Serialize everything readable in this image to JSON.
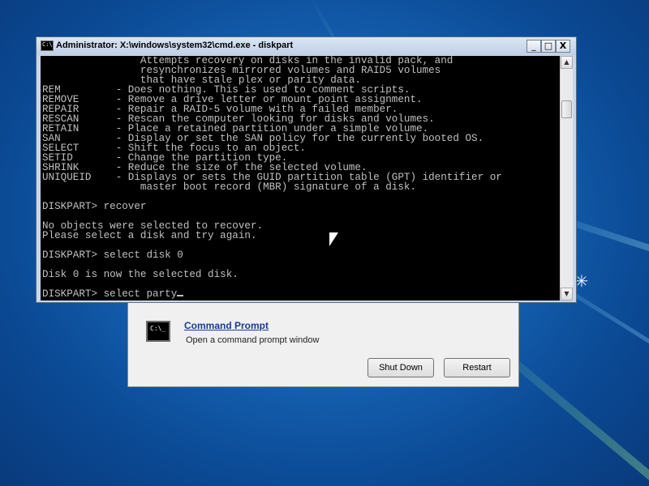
{
  "window": {
    "title": "Administrator: X:\\windows\\system32\\cmd.exe - diskpart",
    "icon": "cmd-icon",
    "minimize": "_",
    "maximize": "□",
    "close": "X"
  },
  "console": {
    "lines": [
      "                Attempts recovery on disks in the invalid pack, and",
      "                resynchronizes mirrored volumes and RAID5 volumes",
      "                that have stale plex or parity data.",
      "REM         - Does nothing. This is used to comment scripts.",
      "REMOVE      - Remove a drive letter or mount point assignment.",
      "REPAIR      - Repair a RAID-5 volume with a failed member.",
      "RESCAN      - Rescan the computer looking for disks and volumes.",
      "RETAIN      - Place a retained partition under a simple volume.",
      "SAN         - Display or set the SAN policy for the currently booted OS.",
      "SELECT      - Shift the focus to an object.",
      "SETID       - Change the partition type.",
      "SHRINK      - Reduce the size of the selected volume.",
      "UNIQUEID    - Displays or sets the GUID partition table (GPT) identifier or",
      "                master boot record (MBR) signature of a disk.",
      "",
      "DISKPART> recover",
      "",
      "No objects were selected to recover.",
      "Please select a disk and try again.",
      "",
      "DISKPART> select disk 0",
      "",
      "Disk 0 is now the selected disk.",
      "",
      "DISKPART> select party"
    ]
  },
  "recovery": {
    "icon_text": "C:\\_",
    "link": "Command Prompt",
    "description": "Open a command prompt window",
    "shutdown": "Shut Down",
    "restart": "Restart"
  },
  "colors": {
    "console_bg": "#000000",
    "console_fg": "#c0c0c0",
    "link": "#1b3a92"
  }
}
